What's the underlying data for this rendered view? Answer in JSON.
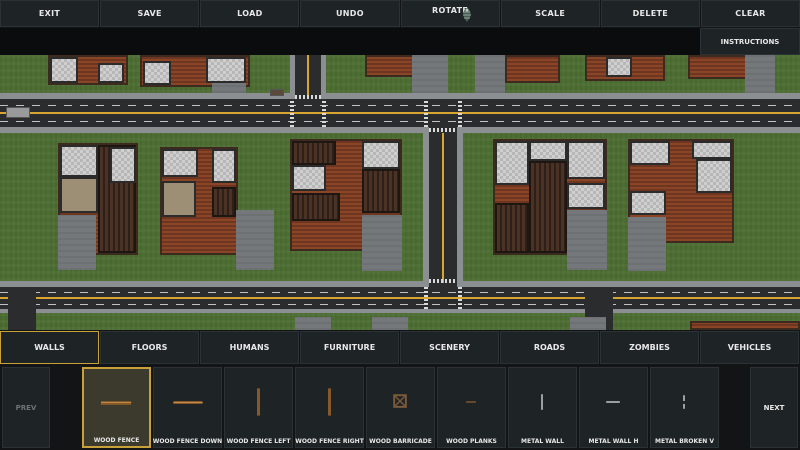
{
  "toolbar": {
    "buttons": [
      {
        "label": "EXIT"
      },
      {
        "label": "SAVE"
      },
      {
        "label": "LOAD"
      },
      {
        "label": "UNDO"
      },
      {
        "label": "ROTATE"
      },
      {
        "label": "SCALE"
      },
      {
        "label": "DELETE"
      },
      {
        "label": "CLEAR"
      }
    ],
    "instructions_label": "INSTRUCTIONS"
  },
  "categories": {
    "items": [
      {
        "label": "WALLS",
        "active": true
      },
      {
        "label": "FLOORS"
      },
      {
        "label": "HUMANS"
      },
      {
        "label": "FURNITURE"
      },
      {
        "label": "SCENERY"
      },
      {
        "label": "ROADS"
      },
      {
        "label": "ZOMBIES"
      },
      {
        "label": "VEHICLES"
      }
    ]
  },
  "palette": {
    "prev_label": "PREV",
    "next_label": "NEXT",
    "items": [
      {
        "label": "WOOD FENCE",
        "selected": true,
        "icon": "wood-fence-horizontal"
      },
      {
        "label": "WOOD FENCE DOWN",
        "icon": "wood-fence-down"
      },
      {
        "label": "WOOD FENCE LEFT",
        "icon": "wood-fence-left"
      },
      {
        "label": "WOOD FENCE RIGHT",
        "icon": "wood-fence-right"
      },
      {
        "label": "WOOD BARRICADE",
        "icon": "wood-barricade"
      },
      {
        "label": "WOOD PLANKS",
        "icon": "wood-planks"
      },
      {
        "label": "METAL WALL",
        "icon": "metal-wall"
      },
      {
        "label": "METAL WALL H",
        "icon": "metal-wall-h"
      },
      {
        "label": "METAL BROKEN V",
        "icon": "metal-broken-v"
      }
    ]
  },
  "colors": {
    "accent": "#c9a13a",
    "button_bg": "#1e2326",
    "grass": "#4d6e33",
    "road": "#2a2c2e",
    "road_line": "#d8a531"
  }
}
